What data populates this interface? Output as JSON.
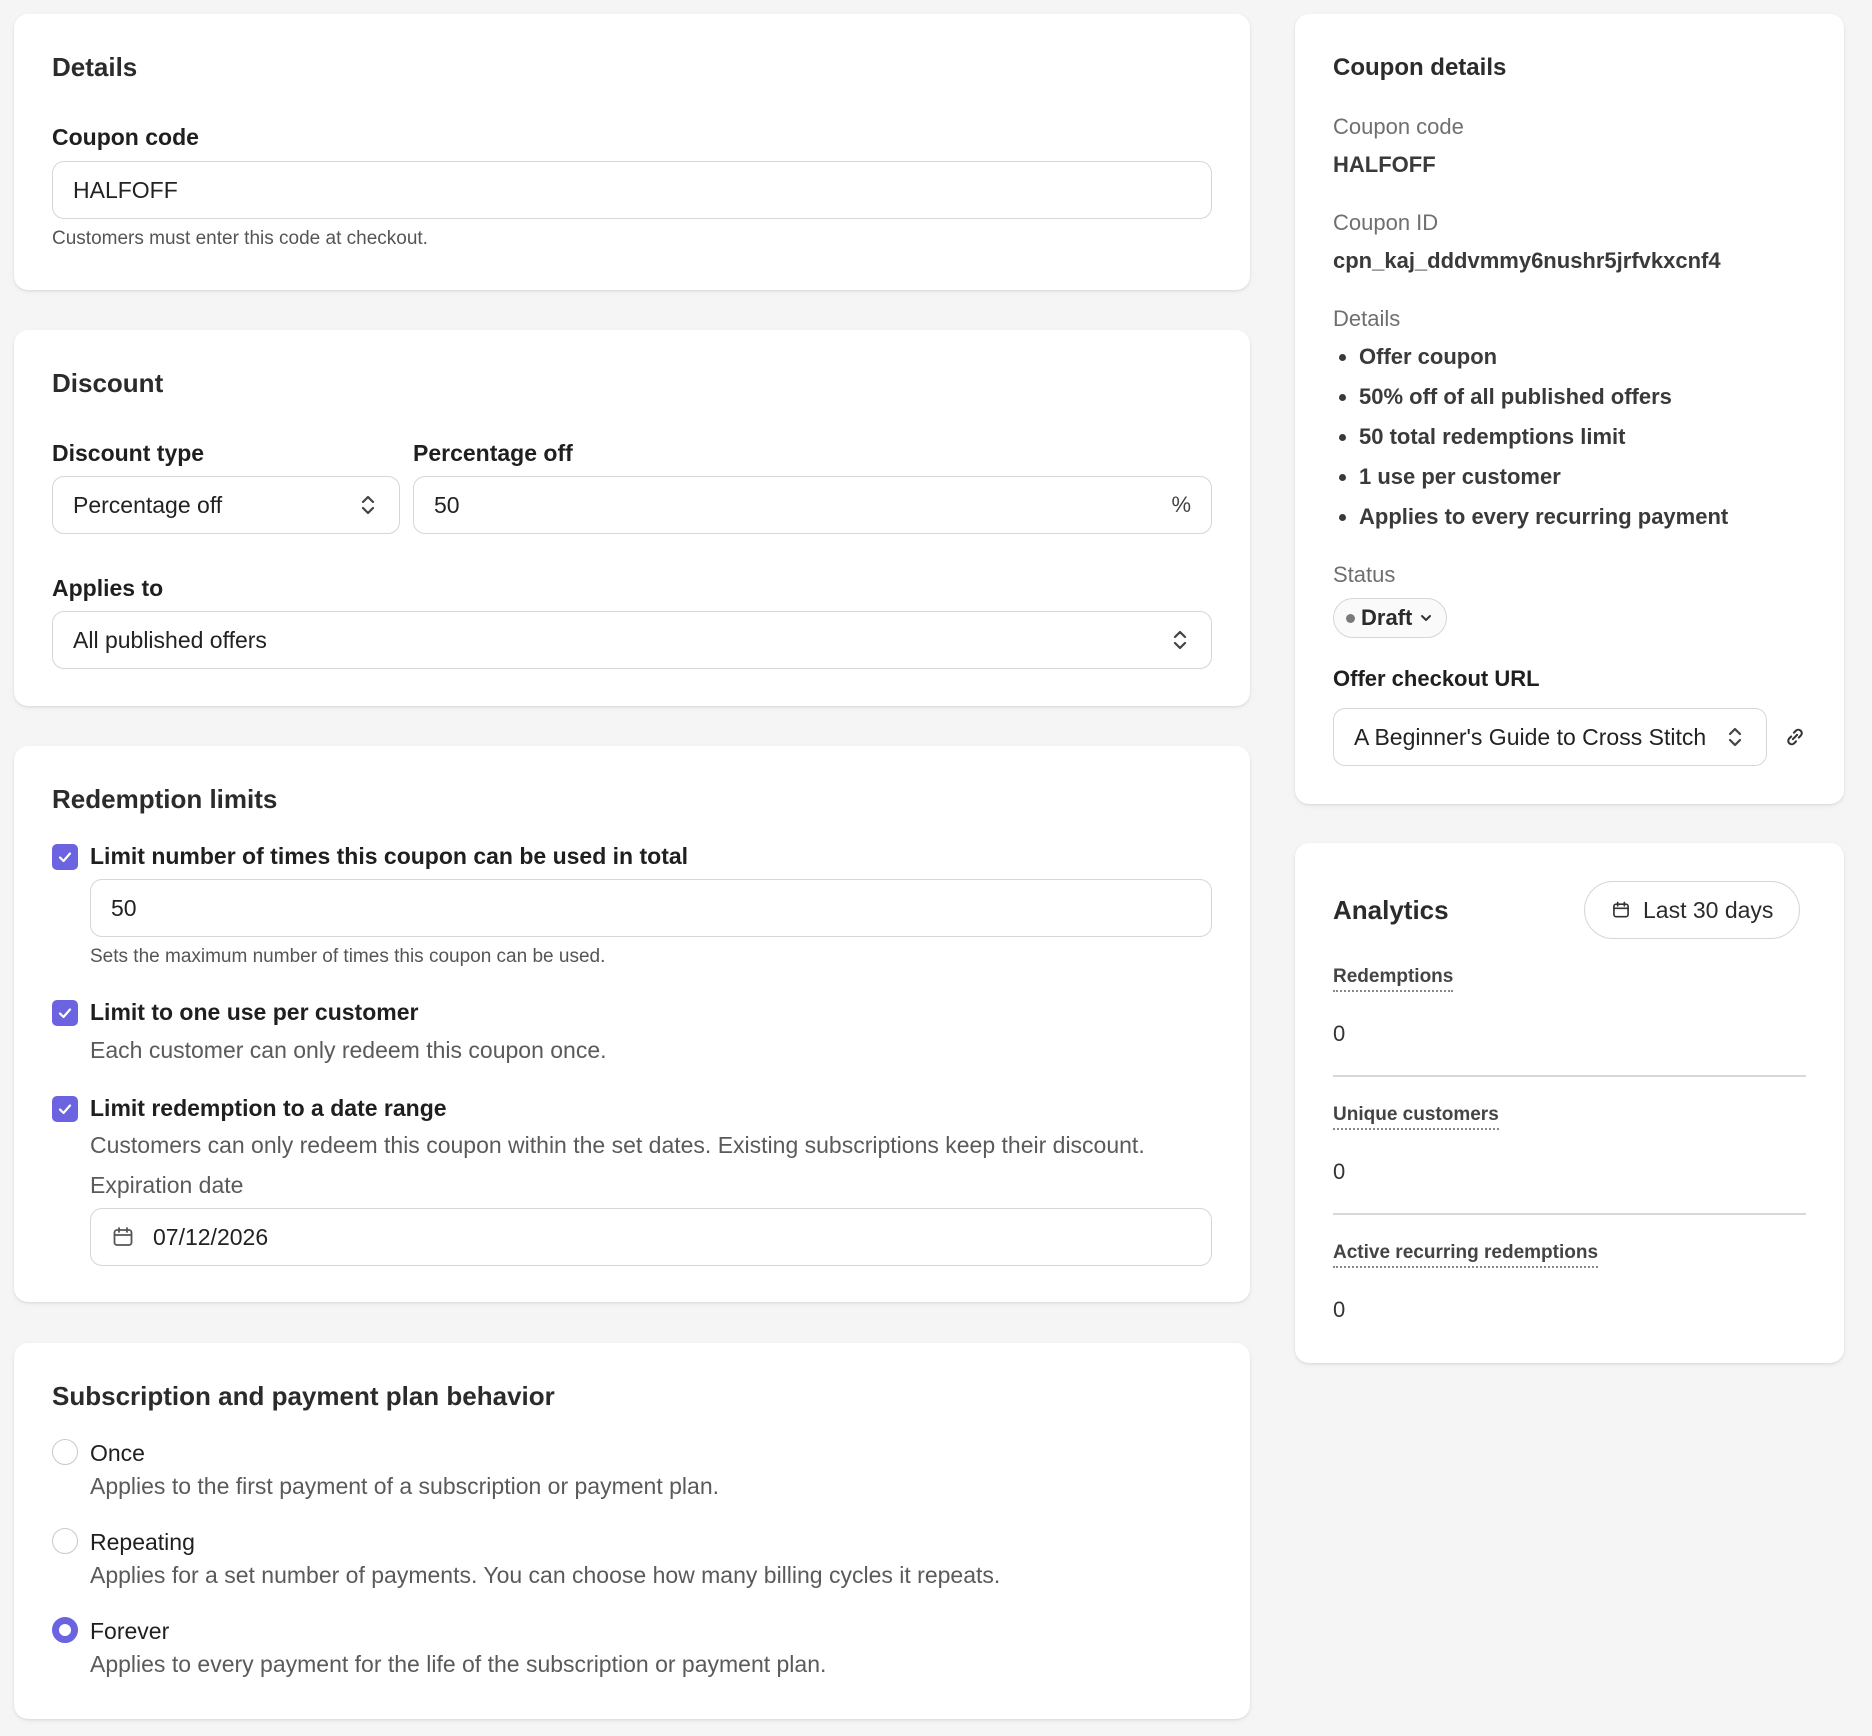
{
  "details": {
    "title": "Details",
    "coupon_code_label": "Coupon code",
    "coupon_code_value": "HALFOFF",
    "coupon_code_help": "Customers must enter this code at checkout."
  },
  "discount": {
    "title": "Discount",
    "type_label": "Discount type",
    "type_value": "Percentage off",
    "percentage_label": "Percentage off",
    "percentage_value": "50",
    "percentage_suffix": "%",
    "applies_label": "Applies to",
    "applies_value": "All published offers"
  },
  "redemption": {
    "title": "Redemption limits",
    "total_limit": {
      "label": "Limit number of times this coupon can be used in total",
      "checked": true,
      "value": "50",
      "help": "Sets the maximum number of times this coupon can be used."
    },
    "per_customer": {
      "label": "Limit to one use per customer",
      "checked": true,
      "desc": "Each customer can only redeem this coupon once."
    },
    "date_range": {
      "label": "Limit redemption to a date range",
      "checked": true,
      "desc": "Customers can only redeem this coupon within the set dates. Existing subscriptions keep their discount.",
      "expiration_label": "Expiration date",
      "expiration_value": "07/12/2026"
    }
  },
  "subscription": {
    "title": "Subscription and payment plan behavior",
    "options": [
      {
        "label": "Once",
        "desc": "Applies to the first payment of a subscription or payment plan.",
        "selected": false
      },
      {
        "label": "Repeating",
        "desc": "Applies for a set number of payments. You can choose how many billing cycles it repeats.",
        "selected": false
      },
      {
        "label": "Forever",
        "desc": "Applies to every payment for the life of the subscription or payment plan.",
        "selected": true
      }
    ]
  },
  "coupon_details": {
    "title": "Coupon details",
    "code_label": "Coupon code",
    "code_value": "HALFOFF",
    "id_label": "Coupon ID",
    "id_value": "cpn_kaj_dddvmmy6nushr5jrfvkxcnf4",
    "details_label": "Details",
    "details_items": [
      "Offer coupon",
      "50% off of all published offers",
      "50 total redemptions limit",
      "1 use per customer",
      "Applies to every recurring payment"
    ],
    "status_label": "Status",
    "status_value": "Draft",
    "checkout_label": "Offer checkout URL",
    "checkout_value": "A Beginner's Guide to Cross Stitch"
  },
  "analytics": {
    "title": "Analytics",
    "range_label": "Last 30 days",
    "metrics": [
      {
        "label": "Redemptions",
        "value": "0"
      },
      {
        "label": "Unique customers",
        "value": "0"
      },
      {
        "label": "Active recurring redemptions",
        "value": "0"
      }
    ]
  },
  "colors": {
    "accent": "#6b63e0",
    "card_bg": "#ffffff",
    "page_bg": "#f5f5f5"
  },
  "icons": [
    "check-icon",
    "updown-chevron-icon",
    "calendar-icon",
    "link-icon",
    "chevron-down-icon"
  ]
}
